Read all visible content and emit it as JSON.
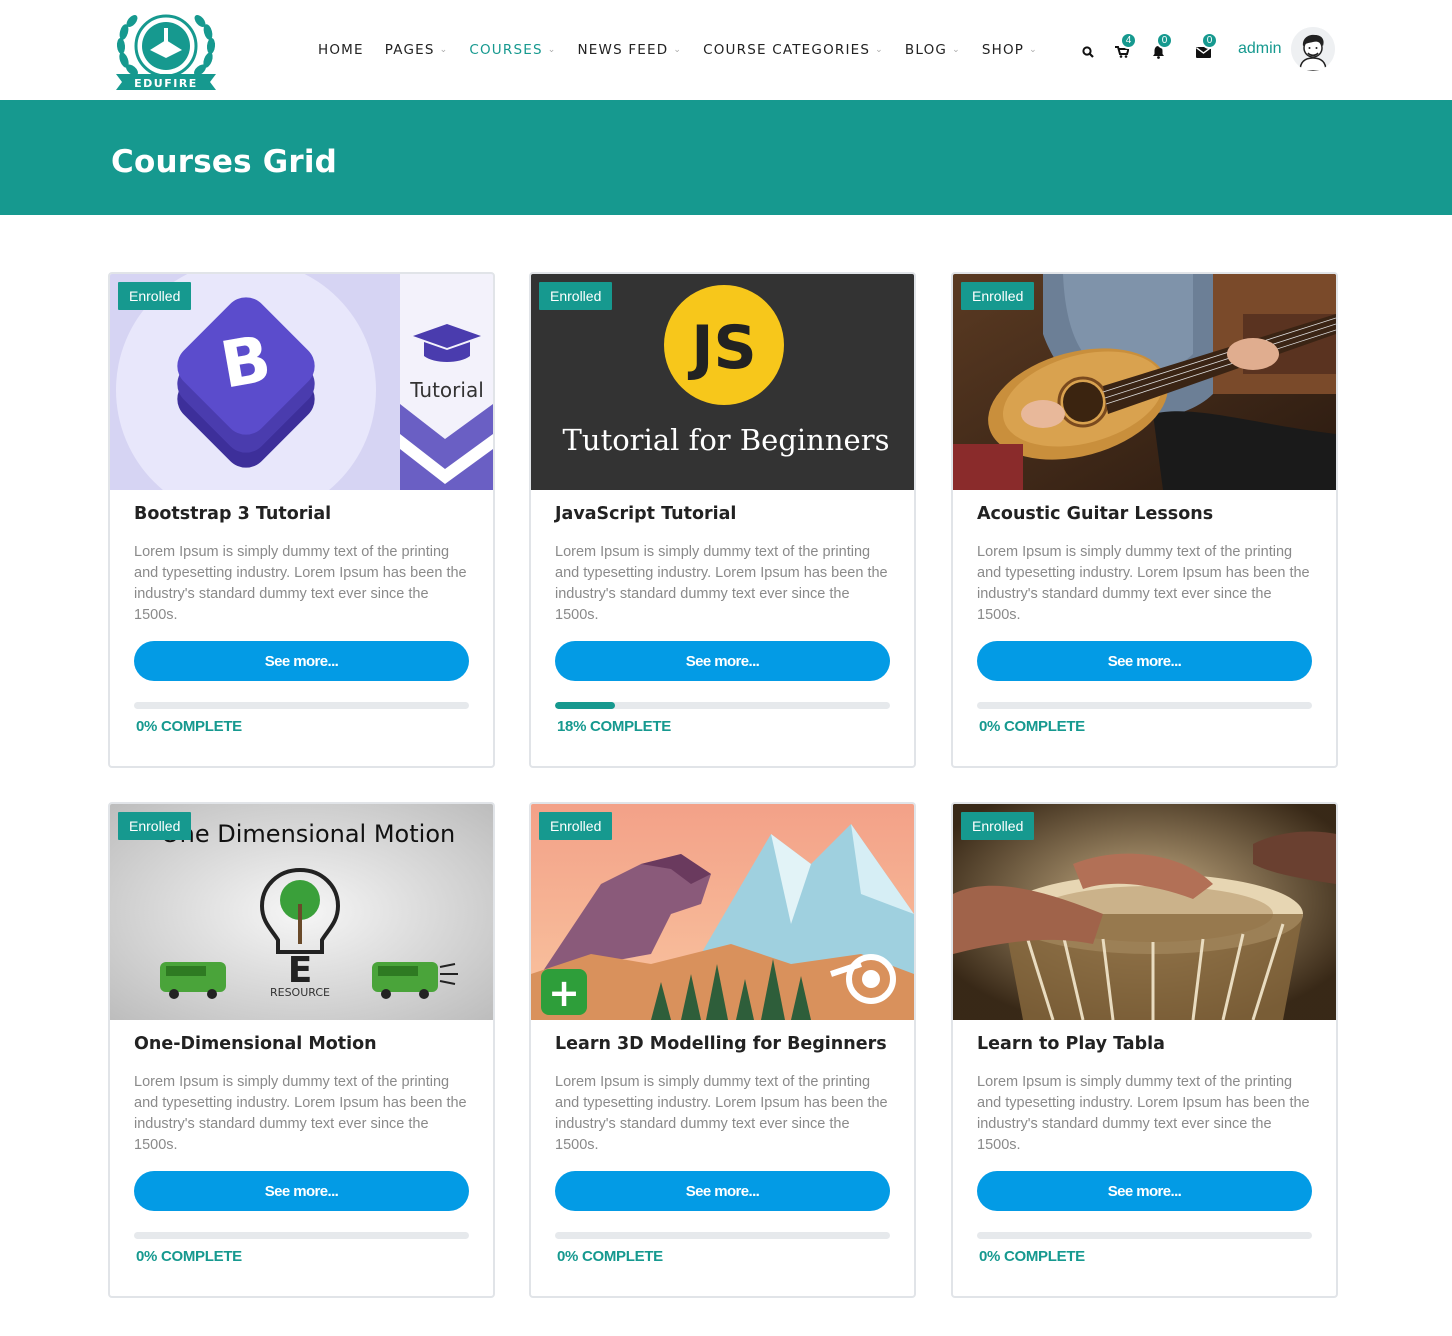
{
  "header": {
    "logo_text": "EDUFIRE",
    "nav": [
      {
        "label": "HOME",
        "dropdown": false,
        "active": false
      },
      {
        "label": "PAGES",
        "dropdown": true,
        "active": false
      },
      {
        "label": "COURSES",
        "dropdown": true,
        "active": true
      },
      {
        "label": "NEWS FEED",
        "dropdown": true,
        "active": false
      },
      {
        "label": "COURSE CATEGORIES",
        "dropdown": true,
        "active": false
      },
      {
        "label": "BLOG",
        "dropdown": true,
        "active": false
      },
      {
        "label": "SHOP",
        "dropdown": true,
        "active": false
      }
    ],
    "cart_count": "4",
    "notification_count": "0",
    "message_count": "0",
    "user_name": "admin",
    "accent_color": "#16998f"
  },
  "banner": {
    "title": "Courses Grid",
    "color": "#16998f"
  },
  "courses": [
    {
      "badge": "Enrolled",
      "title": "Bootstrap 3 Tutorial",
      "description": "Lorem Ipsum is simply dummy text of the printing and typesetting industry. Lorem Ipsum has been the industry's standard dummy text ever since the 1500s.",
      "button": "See more...",
      "progress": 0,
      "progress_text": "0% COMPLETE",
      "thumb_text": "Tutorial"
    },
    {
      "badge": "Enrolled",
      "title": "JavaScript Tutorial",
      "description": "Lorem Ipsum is simply dummy text of the printing and typesetting industry. Lorem Ipsum has been the industry's standard dummy text ever since the 1500s.",
      "button": "See more...",
      "progress": 18,
      "progress_text": "18% COMPLETE",
      "thumb_text": "Tutorial for Beginners"
    },
    {
      "badge": "Enrolled",
      "title": "Acoustic Guitar Lessons",
      "description": "Lorem Ipsum is simply dummy text of the printing and typesetting industry. Lorem Ipsum has been the industry's standard dummy text ever since the 1500s.",
      "button": "See more...",
      "progress": 0,
      "progress_text": "0% COMPLETE"
    },
    {
      "badge": "Enrolled",
      "title": "One-Dimensional Motion",
      "description": "Lorem Ipsum is simply dummy text of the printing and typesetting industry. Lorem Ipsum has been the industry's standard dummy text ever since the 1500s.",
      "button": "See more...",
      "progress": 0,
      "progress_text": "0% COMPLETE",
      "thumb_text": "One Dimensional Motion",
      "thumb_subtext": "RESOURCE"
    },
    {
      "badge": "Enrolled",
      "title": "Learn 3D Modelling for Beginners",
      "description": "Lorem Ipsum is simply dummy text of the printing and typesetting industry. Lorem Ipsum has been the industry's standard dummy text ever since the 1500s.",
      "button": "See more...",
      "progress": 0,
      "progress_text": "0% COMPLETE"
    },
    {
      "badge": "Enrolled",
      "title": "Learn to Play Tabla",
      "description": "Lorem Ipsum is simply dummy text of the printing and typesetting industry. Lorem Ipsum has been the industry's standard dummy text ever since the 1500s.",
      "button": "See more...",
      "progress": 0,
      "progress_text": "0% COMPLETE"
    }
  ]
}
